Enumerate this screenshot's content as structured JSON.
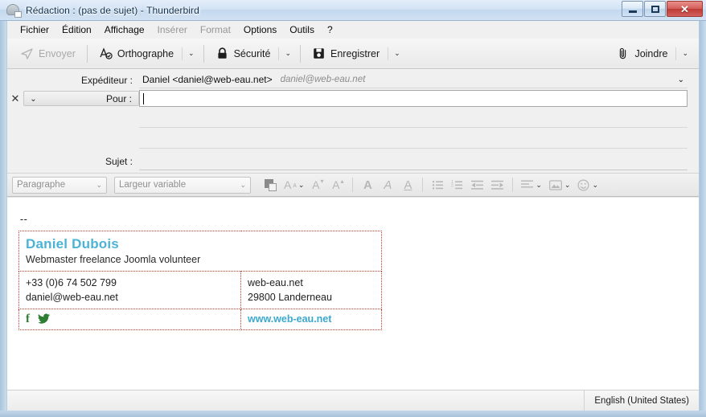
{
  "window": {
    "title": "Rédaction : (pas de sujet) - Thunderbird",
    "icon": "thunderbird-compose-icon",
    "controls": {
      "minimize": "minimize-button",
      "restore": "restore-button",
      "close_glyph": "✕"
    }
  },
  "menubar": {
    "items": [
      {
        "label": "Fichier",
        "disabled": false
      },
      {
        "label": "Édition",
        "disabled": false
      },
      {
        "label": "Affichage",
        "disabled": false
      },
      {
        "label": "Insérer",
        "disabled": true
      },
      {
        "label": "Format",
        "disabled": true
      },
      {
        "label": "Options",
        "disabled": false
      },
      {
        "label": "Outils",
        "disabled": false
      },
      {
        "label": "?",
        "disabled": false
      }
    ]
  },
  "toolbar": {
    "send_label": "Envoyer",
    "spelling_label": "Orthographe",
    "security_label": "Sécurité",
    "save_label": "Enregistrer",
    "attach_label": "Joindre",
    "chevron": "⌄"
  },
  "headers": {
    "from_label": "Expéditeur :",
    "from_name": "Daniel <daniel@web-eau.net>",
    "from_identity": "daniel@web-eau.net",
    "to_label": "Pour :",
    "to_value": "",
    "remove_glyph": "✕",
    "recipient_type_chevron": "⌄",
    "subject_label": "Sujet :",
    "subject_value": ""
  },
  "formatbar": {
    "paragraph_select": "Paragraphe",
    "font_select": "Largeur variable",
    "chevron": "⌄",
    "buttons": [
      {
        "name": "text-color-swatch",
        "glyph": ""
      },
      {
        "name": "font-size-button",
        "glyph": "A"
      },
      {
        "name": "decrease-size-button",
        "glyph": "A"
      },
      {
        "name": "increase-size-button",
        "glyph": "A"
      },
      {
        "name": "bold-button",
        "glyph": "A"
      },
      {
        "name": "italic-button",
        "glyph": "A"
      },
      {
        "name": "underline-button",
        "glyph": "A"
      },
      {
        "name": "bullet-list-button",
        "glyph": "≔"
      },
      {
        "name": "numbered-list-button",
        "glyph": "≔"
      },
      {
        "name": "outdent-button",
        "glyph": "⇤"
      },
      {
        "name": "indent-button",
        "glyph": "⇥"
      },
      {
        "name": "align-button",
        "glyph": "≡"
      },
      {
        "name": "insert-image-button",
        "glyph": "▨"
      },
      {
        "name": "smiley-button",
        "glyph": "☺"
      }
    ]
  },
  "body": {
    "signature_separator": "--",
    "signature": {
      "name": "Daniel Dubois",
      "role": "Webmaster freelance Joomla volunteer",
      "phone": "+33 (0)6 74 502 799",
      "email": "daniel@web-eau.net",
      "site": "web-eau.net",
      "city": "29800 Landerneau",
      "facebook_glyph": "f",
      "twitter_icon": "twitter-bird-icon",
      "url": "www.web-eau.net"
    }
  },
  "statusbar": {
    "language": "English (United States)"
  },
  "colors": {
    "sig_name": "#4cb3d4",
    "sig_url": "#3ba8ce",
    "social_green": "#2e7d32",
    "table_border": "#c0392b",
    "close_red": "#c0392b"
  }
}
